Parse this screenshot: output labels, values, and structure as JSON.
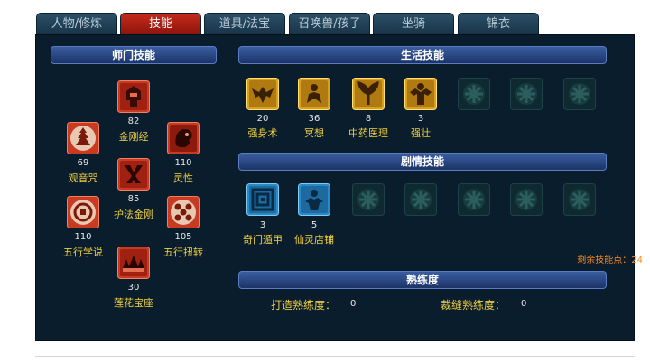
{
  "tabs": [
    "人物/修炼",
    "技能",
    "道具/法宝",
    "召唤兽/孩子",
    "坐骑",
    "锦衣"
  ],
  "active_tab": "技能",
  "sections": {
    "school": "师门技能",
    "life": "生活技能",
    "story": "剧情技能",
    "proficiency": "熟练度"
  },
  "school_skills": [
    {
      "value": "82",
      "name": "金刚经",
      "icon": "idol-icon"
    },
    {
      "value": "69",
      "name": "观音咒",
      "icon": "pagoda-icon"
    },
    {
      "value": "110",
      "name": "灵性",
      "icon": "demon-head-icon"
    },
    {
      "value": "85",
      "name": "护法金刚",
      "icon": "guardian-icon"
    },
    {
      "value": "110",
      "name": "五行学说",
      "icon": "five-elements-icon"
    },
    {
      "value": "105",
      "name": "五行扭转",
      "icon": "five-dots-icon"
    },
    {
      "value": "30",
      "name": "莲花宝座",
      "icon": "lotus-icon"
    }
  ],
  "life_skills": [
    {
      "value": "20",
      "name": "强身术",
      "icon": "strength-icon"
    },
    {
      "value": "36",
      "name": "冥想",
      "icon": "meditation-icon"
    },
    {
      "value": "8",
      "name": "中药医理",
      "icon": "herb-icon"
    },
    {
      "value": "3",
      "name": "强壮",
      "icon": "muscle-icon"
    }
  ],
  "story_skills": [
    {
      "value": "3",
      "name": "奇门遁甲",
      "icon": "maze-icon"
    },
    {
      "value": "5",
      "name": "仙灵店铺",
      "icon": "fairy-shop-icon"
    }
  ],
  "remaining_points": "剩余技能点：24",
  "proficiency": {
    "forge_label": "打造熟练度：",
    "forge_value": "0",
    "tailor_label": "裁缝熟练度：",
    "tailor_value": "0"
  },
  "colors": {
    "tab_active": "#b8241a",
    "panel_bg": "#0a1d2d",
    "header_bg": "#2a4a8c",
    "label_yellow": "#f0d040",
    "remaining_orange": "#ff8a1c"
  }
}
